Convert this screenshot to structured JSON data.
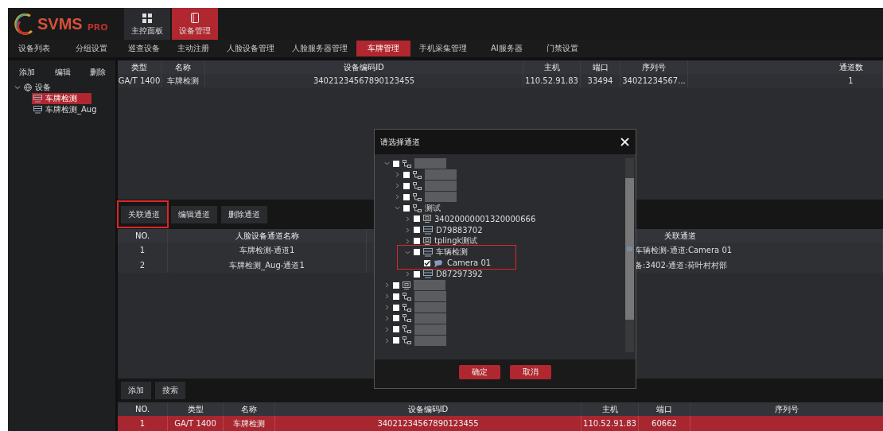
{
  "header": {
    "logo": "SVMS",
    "logo_suffix": "PRO",
    "modules": [
      {
        "label": "主控面板",
        "kind": "grid",
        "selected": false
      },
      {
        "label": "设备管理",
        "kind": "book",
        "selected": true
      }
    ]
  },
  "nav": [
    {
      "label": "设备列表",
      "selected": false
    },
    {
      "label": "分组设置",
      "selected": false
    },
    {
      "label": "巡查设备",
      "selected": false
    },
    {
      "label": "主动注册",
      "selected": false
    },
    {
      "label": "人脸设备管理",
      "selected": false
    },
    {
      "label": "人脸服务器管理",
      "selected": false
    },
    {
      "label": "车牌管理",
      "selected": true
    },
    {
      "label": "手机采集管理",
      "selected": false
    },
    {
      "label": "AI服务器",
      "selected": false
    },
    {
      "label": "门禁设置",
      "selected": false
    }
  ],
  "sidebar": {
    "actions": [
      "添加",
      "编辑",
      "删除"
    ],
    "tree": [
      {
        "label": "设备",
        "expanded": true,
        "children": [
          {
            "label": "车牌检测",
            "selected": true
          },
          {
            "label": "车牌检测_Aug",
            "selected": false
          }
        ]
      }
    ]
  },
  "device_table": {
    "columns": [
      "类型",
      "名称",
      "设备编码ID",
      "主机",
      "端口",
      "序列号",
      "通道数"
    ],
    "rows": [
      [
        "GA/T 1400",
        "车牌检测",
        "34021234567890123455",
        "110.52.91.83",
        "33494",
        "34021234567...",
        "1"
      ]
    ]
  },
  "channel_actions": [
    {
      "label": "关联通道",
      "highlighted": true
    },
    {
      "label": "编辑通道",
      "highlighted": false
    },
    {
      "label": "删除通道",
      "highlighted": false
    }
  ],
  "channel_table": {
    "columns": [
      "NO.",
      "人脸设备通道名称",
      "关联通道"
    ],
    "rows": [
      [
        "1",
        "车牌检测-通道1",
        "车辆检测-通道:Camera 01"
      ],
      [
        "2",
        "车牌检测_Aug-通道1",
        "备:3402-通道:荷叶村村部"
      ]
    ]
  },
  "bottom_actions": [
    "添加",
    "搜索"
  ],
  "bottom_table": {
    "columns": [
      "NO.",
      "类型",
      "名称",
      "设备编码ID",
      "主机",
      "端口",
      "序列号"
    ],
    "rows": [
      {
        "cells": [
          "1",
          "GA/T 1400",
          "车牌检测",
          "34021234567890123455",
          "110.52.91.83",
          "60662"
        ],
        "selected": true
      }
    ]
  },
  "modal": {
    "title": "请选择通道",
    "tree": [
      {
        "kind": "group",
        "expanded": true,
        "checked": false,
        "highlighted": false,
        "children": [
          {
            "kind": "group",
            "expanded": false,
            "checked": false,
            "highlighted": false
          },
          {
            "kind": "group",
            "expanded": false,
            "checked": false,
            "highlighted": false
          },
          {
            "kind": "group",
            "expanded": false,
            "checked": false,
            "highlighted": false
          },
          {
            "kind": "group",
            "label": "测试",
            "expanded": true,
            "checked": false,
            "highlighted": false,
            "children": [
              {
                "kind": "ipc",
                "label": "34020000001320000666",
                "expanded": false,
                "checked": false,
                "highlighted": false
              },
              {
                "kind": "nvr",
                "label": "D79883702",
                "expanded": false,
                "checked": false,
                "highlighted": false
              },
              {
                "kind": "ipc",
                "label": "tplingk测试",
                "expanded": false,
                "checked": false,
                "highlighted": false
              },
              {
                "kind": "nvr",
                "label": "车辆检测",
                "expanded": true,
                "checked": false,
                "highlighted": true,
                "children": [
                  {
                    "kind": "camera",
                    "label": "Camera 01",
                    "checked": true,
                    "highlighted": false
                  }
                ]
              },
              {
                "kind": "nvr",
                "label": "D87297392",
                "expanded": false,
                "checked": false,
                "highlighted": false
              }
            ]
          }
        ]
      },
      {
        "kind": "ipc",
        "expanded": false,
        "checked": false,
        "highlighted": false
      },
      {
        "kind": "group",
        "expanded": false,
        "checked": false,
        "highlighted": false
      },
      {
        "kind": "group",
        "expanded": false,
        "checked": false,
        "highlighted": false
      },
      {
        "kind": "group",
        "expanded": false,
        "checked": false,
        "highlighted": false
      },
      {
        "kind": "group",
        "expanded": false,
        "checked": false,
        "highlighted": false
      },
      {
        "kind": "group",
        "expanded": false,
        "checked": false,
        "highlighted": false
      }
    ],
    "buttons": [
      "确定",
      "取消"
    ]
  }
}
